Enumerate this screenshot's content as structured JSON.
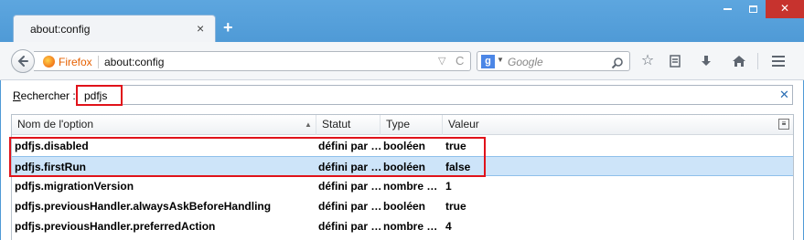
{
  "window": {
    "tab_title": "about:config",
    "tab_close": "×",
    "new_tab": "+",
    "close_glyph": "✕"
  },
  "nav": {
    "identity_label": "Firefox",
    "url": "about:config",
    "search_engine": "g",
    "search_placeholder": "Google",
    "url_dropdown_glyph": "▽",
    "reload_glyph": "C",
    "search_go_glyph": "⌕"
  },
  "filter": {
    "label_accesskey": "R",
    "label_rest": "echercher :",
    "value": "pdfjs",
    "clear_glyph": "✕"
  },
  "columns": {
    "name": "Nom de l'option",
    "status": "Statut",
    "type": "Type",
    "value": "Valeur"
  },
  "rows": [
    {
      "name": "pdfjs.disabled",
      "status": "défini par …",
      "type": "booléen",
      "value": "true"
    },
    {
      "name": "pdfjs.firstRun",
      "status": "défini par …",
      "type": "booléen",
      "value": "false"
    },
    {
      "name": "pdfjs.migrationVersion",
      "status": "défini par …",
      "type": "nombre …",
      "value": "1"
    },
    {
      "name": "pdfjs.previousHandler.alwaysAskBeforeHandling",
      "status": "défini par …",
      "type": "booléen",
      "value": "true"
    },
    {
      "name": "pdfjs.previousHandler.preferredAction",
      "status": "défini par …",
      "type": "nombre …",
      "value": "4"
    }
  ],
  "selected_row_index": 1,
  "icons": [
    "back-arrow-icon",
    "firefox-logo-icon",
    "google-icon",
    "search-icon",
    "bookmark-star-icon",
    "reading-list-icon",
    "download-icon",
    "home-icon",
    "menu-icon",
    "column-picker-icon",
    "sort-ascending-icon"
  ],
  "colors": {
    "title_bar": "#5aa4de",
    "highlight_box": "#e0121a",
    "selected_row": "#cde4f9",
    "close_button": "#c7332e",
    "identity_label": "#e66000"
  }
}
